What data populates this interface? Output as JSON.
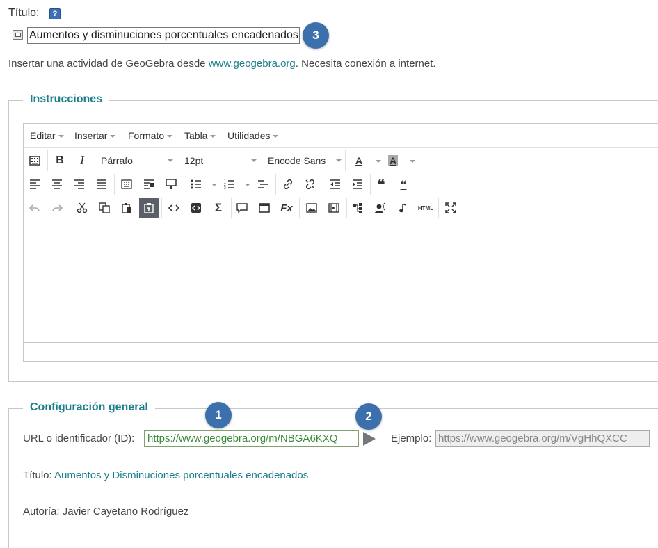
{
  "title_section": {
    "label": "Título:",
    "help_icon": "question-icon",
    "input_value": "Aumentos y disminuciones porcentuales encadenados",
    "badge_3": "3"
  },
  "intro": {
    "before": "Insertar una actividad de GeoGebra desde ",
    "link": "www.geogebra.org",
    "after": ". Necesita conexión a internet."
  },
  "instructions": {
    "legend": "Instrucciones",
    "menu": [
      "Editar",
      "Insertar",
      "Formato",
      "Tabla",
      "Utilidades"
    ],
    "format_select": "Párrafo",
    "size_select": "12pt",
    "font_select": "Encode Sans",
    "font_color_label": "A",
    "bg_color_label": "A"
  },
  "config": {
    "legend": "Configuración general",
    "url_label": "URL o identificador (ID):",
    "url_value": "https://www.geogebra.org/m/NBGA6KXQ",
    "example_label": "Ejemplo:",
    "example_placeholder": "https://www.geogebra.org/m/VgHhQXCC",
    "title_label": "Título: ",
    "title_value": "Aumentos y Disminuciones porcentuales encadenados",
    "author_label": "Autoría: ",
    "author_value": "Javier Cayetano Rodríguez",
    "badge_1": "1",
    "badge_2": "2"
  },
  "colors": {
    "accent": "#1b7e8c",
    "badge": "#3c70ad",
    "url_text": "#3a8a3a"
  }
}
